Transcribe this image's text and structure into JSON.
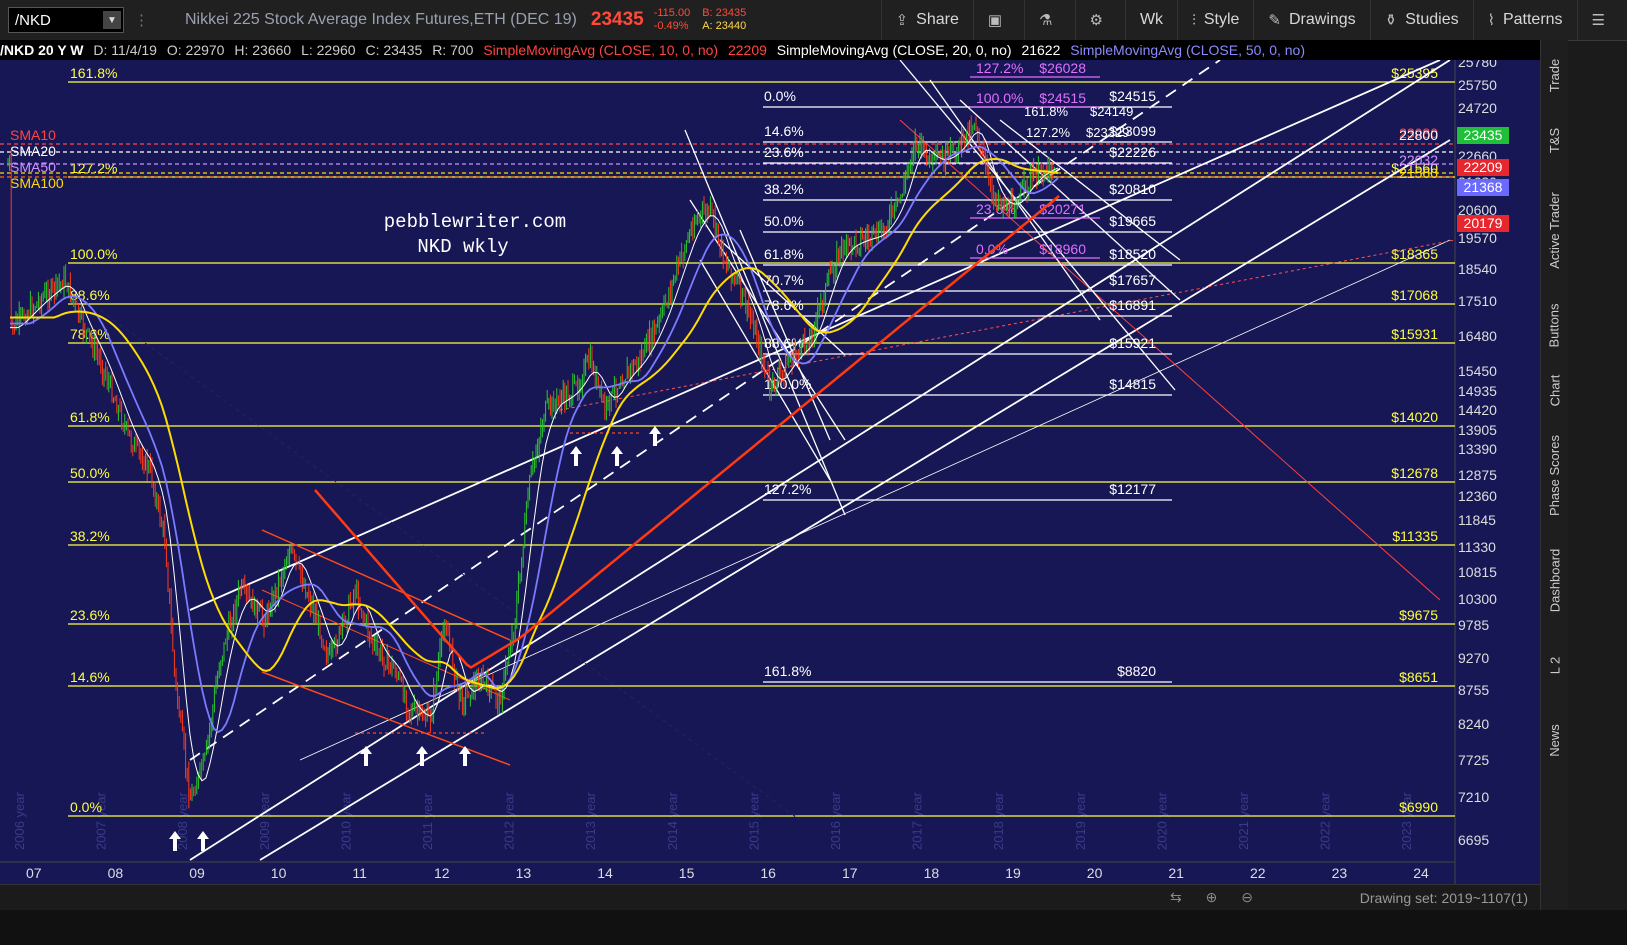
{
  "toolbar": {
    "symbol": "/NKD",
    "instrument": "Nikkei 225 Stock Average Index Futures,ETH (DEC 19)",
    "last": "23435",
    "change": "-115.00",
    "change_pct": "-0.49%",
    "bid": "B: 23435",
    "ask": "A: 23440",
    "buttons": [
      "Share",
      "Wk",
      "Style",
      "Drawings",
      "Studies",
      "Patterns"
    ]
  },
  "info_bar": {
    "symbol_period": "/NKD 20 Y W",
    "date": "D: 11/4/19",
    "open": "O: 22970",
    "high": "H: 23660",
    "low": "L: 22960",
    "close": "C: 23435",
    "range": "R: 700",
    "sma10_label": "SimpleMovingAvg (CLOSE, 10, 0, no)",
    "sma10_value": "22209",
    "sma20_label": "SimpleMovingAvg (CLOSE, 20, 0, no)",
    "sma20_value": "21622",
    "sma50_label": "SimpleMovingAvg (CLOSE, 50, 0, no)"
  },
  "colors": {
    "background": "#171756",
    "fib": "#ffff3c",
    "sma10": "#ff4444",
    "sma20": "#ffffff",
    "sma50": "#7b7bff",
    "sma100": "#ffdc00",
    "up": "#2ec92e",
    "down": "#ff3a1a"
  },
  "annotation": {
    "line1": "pebblewriter.com",
    "line2": "NKD wkly"
  },
  "sma_labels": [
    {
      "text": "SMA10",
      "color": "#ff4444"
    },
    {
      "text": "SMA20",
      "color": "#ffffff"
    },
    {
      "text": "SMA50",
      "color": "#d090ff"
    },
    {
      "text": "SMA100",
      "color": "#ffdc00"
    }
  ],
  "main_fib": [
    {
      "pct": "161.8%",
      "price": "$25395"
    },
    {
      "pct": "127.2%",
      "price": "$21560"
    },
    {
      "pct": "100.0%",
      "price": "$18365"
    },
    {
      "pct": "88.6%",
      "price": "$17068"
    },
    {
      "pct": "78.6%",
      "price": "$15931"
    },
    {
      "pct": "61.8%",
      "price": "$14020"
    },
    {
      "pct": "50.0%",
      "price": "$12678"
    },
    {
      "pct": "38.2%",
      "price": "$11335"
    },
    {
      "pct": "23.6%",
      "price": "$9675"
    },
    {
      "pct": "14.6%",
      "price": "$8651"
    },
    {
      "pct": "0.0%",
      "price": "$6990"
    }
  ],
  "inner_fib": [
    {
      "pct": "0.0%",
      "price": "$24515"
    },
    {
      "pct": "14.6%",
      "price": "$23099"
    },
    {
      "pct": "23.6%",
      "price": "$22226"
    },
    {
      "pct": "38.2%",
      "price": "$20810"
    },
    {
      "pct": "50.0%",
      "price": "$19665"
    },
    {
      "pct": "61.8%",
      "price": "$18520"
    },
    {
      "pct": "70.7%",
      "price": "$17657"
    },
    {
      "pct": "78.6%",
      "price": "$16891"
    },
    {
      "pct": "88.6%",
      "price": "$15921"
    },
    {
      "pct": "100.0%",
      "price": "$14815"
    },
    {
      "pct": "127.2%",
      "price": "$12177"
    },
    {
      "pct": "161.8%",
      "price": "$8820"
    }
  ],
  "pink_fib": [
    {
      "pct": "127.2%",
      "price": "$26028"
    },
    {
      "pct": "100.0%",
      "price": "$24515"
    },
    {
      "pct": "23.6%",
      "price": "$20271"
    },
    {
      "pct": "0.0%",
      "price": "$18960"
    }
  ],
  "small_fib": [
    {
      "text": "161.8%"
    },
    {
      "text": "$24149"
    },
    {
      "text": "127.2%"
    },
    {
      "text": "$23329"
    }
  ],
  "price_axis": [
    "25780",
    "25750",
    "24720",
    "23690",
    "22660",
    "21630",
    "20600",
    "19570",
    "18540",
    "17510",
    "16480",
    "15450",
    "14935",
    "14420",
    "13905",
    "13390",
    "12875",
    "12360",
    "11845",
    "11330",
    "10815",
    "10300",
    "9785",
    "9270",
    "8755",
    "8240",
    "7725",
    "7210",
    "6695"
  ],
  "price_tags": [
    {
      "text": "23080",
      "color": "#ff4444"
    },
    {
      "text": "22800",
      "color": "#ffffff"
    },
    {
      "text": "23435",
      "color": "#1fbf3a"
    },
    {
      "text": "22032",
      "color": "#d090ff"
    },
    {
      "text": "22209",
      "color": "#e8262e"
    },
    {
      "text": "21560",
      "color": "#ffdc00"
    },
    {
      "text": "21368",
      "color": "#6a6aff"
    },
    {
      "text": "20179",
      "color": "#e8262e"
    }
  ],
  "time_axis": [
    "07",
    "08",
    "09",
    "10",
    "11",
    "12",
    "13",
    "14",
    "15",
    "16",
    "17",
    "18",
    "19",
    "20",
    "21",
    "22",
    "23",
    "24"
  ],
  "year_labels": [
    "2006 year",
    "2007 year",
    "2008 year",
    "2009 year",
    "2010 year",
    "2011 year",
    "2012 year",
    "2013 year",
    "2014 year",
    "2015 year",
    "2016 year",
    "2017 year",
    "2018 year",
    "2019 year",
    "2020 year",
    "2021 year",
    "2022 year",
    "2023 year"
  ],
  "side_tabs": [
    "Trade",
    "T&S",
    "Active Trader",
    "Buttons",
    "Chart",
    "Phase Scores",
    "Dashboard",
    "L 2",
    "News"
  ],
  "bottom": {
    "drawing_set": "Drawing set: 2019~1107(1)"
  }
}
